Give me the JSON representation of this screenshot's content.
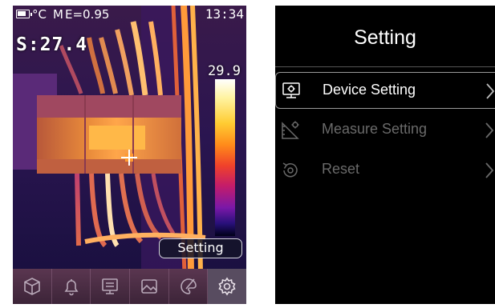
{
  "camera_screen": {
    "status": {
      "temp_unit": "°C",
      "mode": "M",
      "emissivity": "E=0.95",
      "time": "13:34"
    },
    "spot_temperature": "S:27.4",
    "scale_max": "29.9",
    "tooltip": "Setting",
    "toolbar": [
      {
        "icon": "cube-icon"
      },
      {
        "icon": "bell-icon"
      },
      {
        "icon": "monitor-icon"
      },
      {
        "icon": "image-icon"
      },
      {
        "icon": "palette-icon"
      },
      {
        "icon": "gear-icon",
        "active": true
      }
    ]
  },
  "settings_screen": {
    "title": "Setting",
    "items": [
      {
        "label": "Device Setting",
        "icon": "device-monitor-icon",
        "selected": true
      },
      {
        "label": "Measure Setting",
        "icon": "measure-icon",
        "selected": false
      },
      {
        "label": "Reset",
        "icon": "reset-icon",
        "selected": false
      }
    ]
  },
  "colors": {
    "menu_background": "#000000",
    "selected_text": "#ffffff",
    "dim_text": "#6a6a6a",
    "toolbar": "#4a2e44"
  }
}
